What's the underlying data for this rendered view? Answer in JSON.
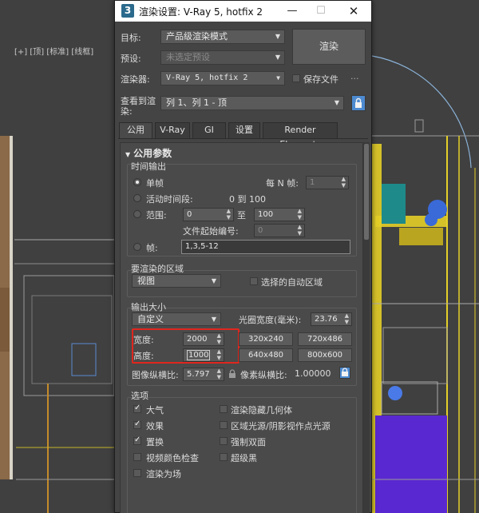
{
  "viewport": {
    "label": "[+] [顶] [标准] [线框]"
  },
  "window": {
    "title": "渲染设置: V-Ray 5, hotfix 2",
    "app_icon": "3",
    "minimize": "—",
    "maximize": "☐",
    "close": "✕"
  },
  "top": {
    "target_label": "目标:",
    "target_value": "产品级渲染模式",
    "preset_label": "预设:",
    "preset_value": "未选定预设",
    "renderer_label": "渲染器:",
    "renderer_value": "V-Ray 5, hotfix 2",
    "save_file_label": "保存文件",
    "more": "...",
    "render_button": "渲染",
    "view_label_1": "查看到渲",
    "view_label_2": "染:",
    "view_value": "列 1、列 1 - 顶"
  },
  "tabs": [
    {
      "label": "公用"
    },
    {
      "label": "V-Ray"
    },
    {
      "label": "GI"
    },
    {
      "label": "设置"
    },
    {
      "label": "Render Elements"
    }
  ],
  "common": {
    "rollout_title": "公用参数",
    "time_output": {
      "title": "时间输出",
      "single": "单帧",
      "every_n": "每 N 帧:",
      "every_n_value": "1",
      "active_segment": "活动时间段:",
      "active_range": "0 到 100",
      "range": "范围:",
      "range_from": "0",
      "to": "至",
      "range_to": "100",
      "file_start": "文件起始编号:",
      "file_start_value": "0",
      "frames": "帧:",
      "frames_value": "1,3,5-12"
    },
    "area": {
      "title": "要渲染的区域",
      "value": "视图",
      "auto_region": "选择的自动区域"
    },
    "output_size": {
      "title": "输出大小",
      "preset": "自定义",
      "aperture_label": "光圈宽度(毫米):",
      "aperture_value": "23.76",
      "width_label": "宽度:",
      "width_value": "2000",
      "height_label": "高度:",
      "height_value": "1000",
      "presets": [
        "320x240",
        "720x486",
        "640x480",
        "800x600"
      ],
      "image_aspect_label": "图像纵横比:",
      "image_aspect_value": "5.797",
      "pixel_aspect_label": "像素纵横比:",
      "pixel_aspect_value": "1.00000"
    },
    "options": {
      "title": "选项",
      "left": [
        {
          "label": "大气",
          "checked": true
        },
        {
          "label": "效果",
          "checked": true
        },
        {
          "label": "置换",
          "checked": true
        },
        {
          "label": "视频颜色检查",
          "checked": false
        },
        {
          "label": "渲染为场",
          "checked": false
        }
      ],
      "right": [
        {
          "label": "渲染隐藏几何体",
          "checked": false
        },
        {
          "label": "区域光源/阴影视作点光源",
          "checked": false
        },
        {
          "label": "强制双面",
          "checked": false
        },
        {
          "label": "超级黑",
          "checked": false
        }
      ]
    }
  }
}
